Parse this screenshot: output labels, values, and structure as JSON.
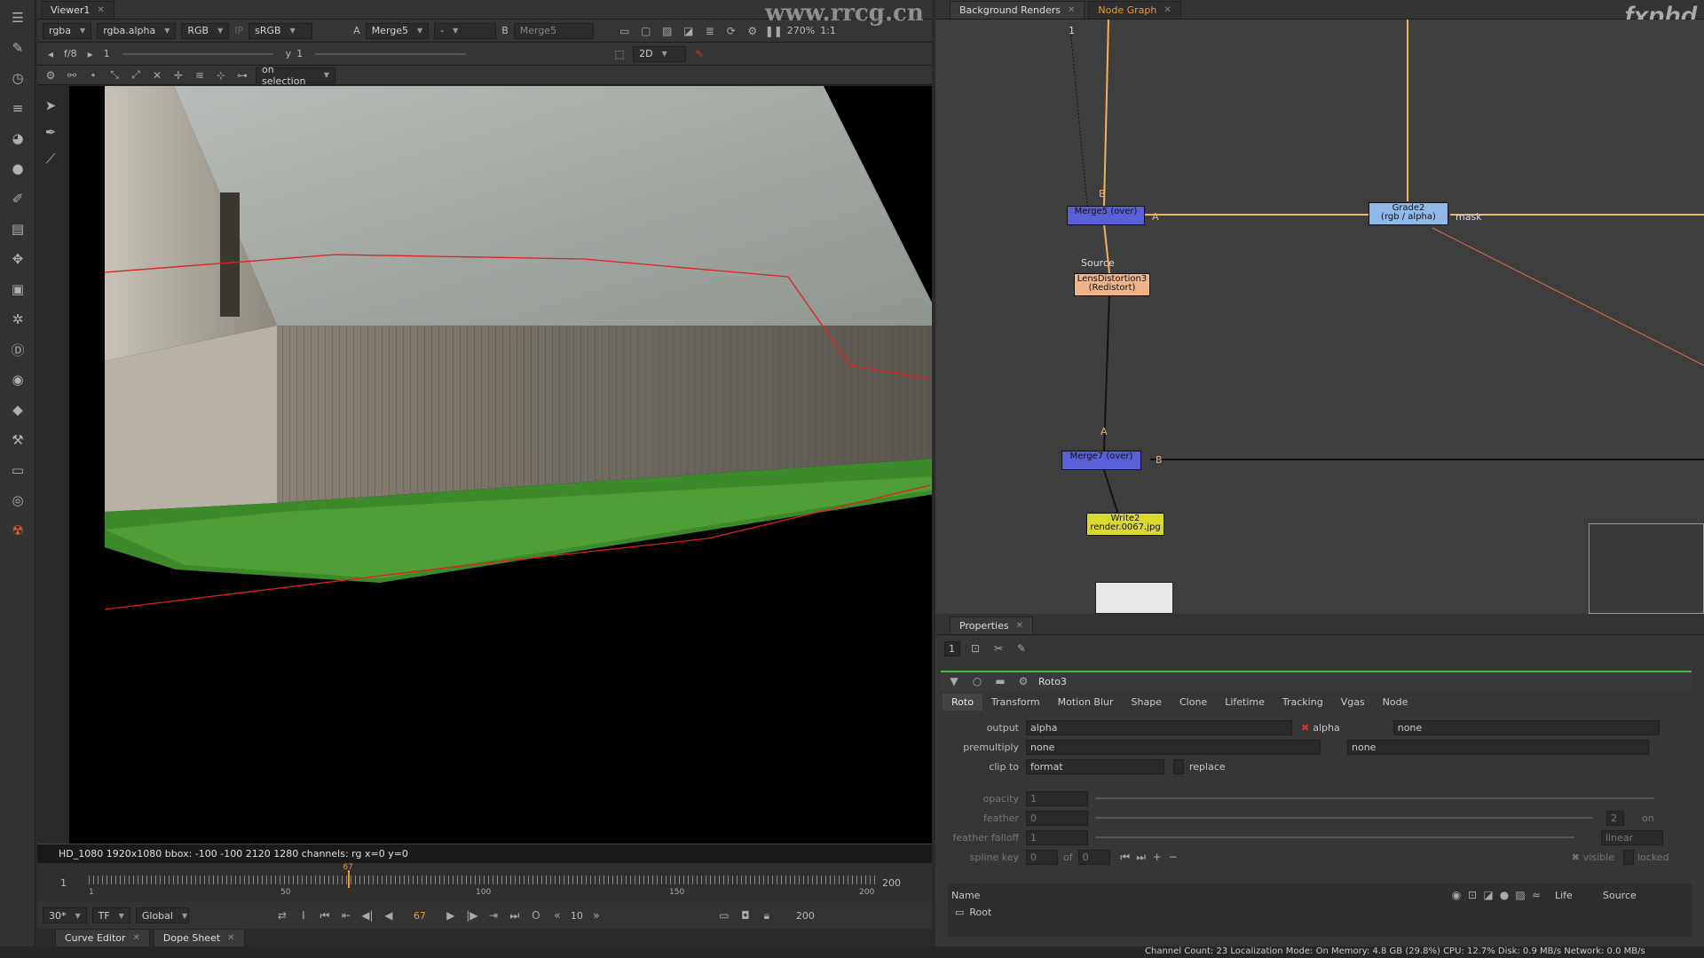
{
  "viewer": {
    "tab": "Viewer1",
    "channels": "rgba",
    "alpha": "rgba.alpha",
    "rgb": "RGB",
    "ip": "IP",
    "lut": "sRGB",
    "a_label": "A",
    "a_input": "Merge5",
    "dash": "-",
    "b_label": "B",
    "b_input": "Merge5",
    "zoom": "270%",
    "ratio": "1:1",
    "fstop": "f/8",
    "frame_field": "1",
    "y_label": "y",
    "y_value": "1",
    "view_mode": "2D",
    "roto_mode": "on selection",
    "info": "HD_1080 1920x1080  bbox: -100 -100 2120 1280 channels: rg  x=0 y=0"
  },
  "timeline": {
    "start": "1",
    "end": "200",
    "current": "67",
    "ticks": [
      "1",
      "50",
      "100",
      "150",
      "200"
    ],
    "fps": "30*",
    "tf": "TF",
    "scope": "Global",
    "step": "10",
    "playhead_fraction": 0.33
  },
  "bottom_tabs": [
    "Curve Editor",
    "Dope Sheet"
  ],
  "right": {
    "tabs": [
      "Background Renders",
      "Node Graph"
    ],
    "active_tab": "Node Graph",
    "brand": "fxphd"
  },
  "nodes": {
    "merge5": "Merge5 (over)",
    "grade2_line1": "Grade2",
    "grade2_line2": "(rgb / alpha)",
    "lens_line1": "LensDistortion3",
    "lens_line2": "(Redistort)",
    "merge7": "Merge7 (over)",
    "write_line1": "Write2",
    "write_line2": "render.0067.jpg",
    "port_b": "B",
    "port_a": "A",
    "port_mask": "mask",
    "port_source": "Source",
    "port_a2": "A",
    "port_b2": "B",
    "top_num": "1"
  },
  "properties": {
    "title": "Properties",
    "count": "1",
    "node_name": "Roto3",
    "tabs": [
      "Roto",
      "Transform",
      "Motion Blur",
      "Shape",
      "Clone",
      "Lifetime",
      "Tracking",
      "Vgas",
      "Node"
    ],
    "output_label": "output",
    "output_value": "alpha",
    "output_alpha": "alpha",
    "output_none": "none",
    "premult_label": "premultiply",
    "premult_value": "none",
    "premult_none": "none",
    "clip_label": "clip to",
    "clip_value": "format",
    "replace_label": "replace",
    "opacity_label": "opacity",
    "opacity_value": "1",
    "feather_label": "feather",
    "feather_value": "0",
    "feather_falloff_label": "feather falloff",
    "feather_falloff_value": "1",
    "falloff_mode": "linear",
    "feather_num": "2",
    "on_label": "on",
    "spline_key_label": "spline key",
    "spline_key_value": "0",
    "of_label": "of",
    "of_value": "0",
    "visible_label": "visible",
    "locked_label": "locked",
    "list_name": "Name",
    "list_life": "Life",
    "list_source": "Source",
    "list_root": "Root"
  },
  "status": "Channel Count: 23  Localization Mode: On  Memory: 4.8 GB (29.8%)  CPU: 12.7%  Disk: 0.9 MB/s  Network: 0.0 MB/s",
  "watermark": "www.rrcg.cn"
}
